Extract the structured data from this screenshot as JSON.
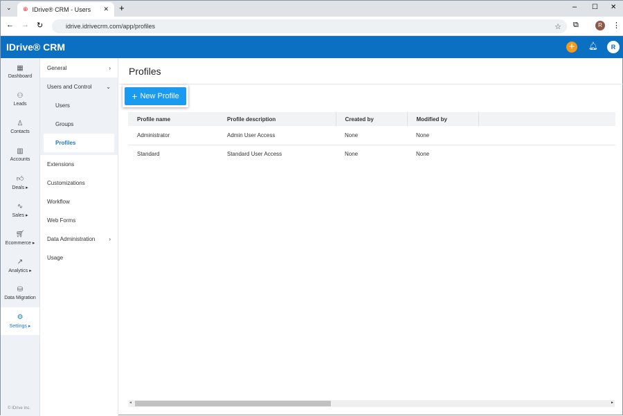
{
  "browser": {
    "tab_title": "IDrive® CRM - Users",
    "url": "idrive.idrivecrm.com/app/profiles",
    "profile_initial": "R"
  },
  "app": {
    "logo": "IDrive® CRM",
    "user_initial": "R"
  },
  "rail": [
    {
      "label": "Dashboard",
      "icon": "dashboard-icon"
    },
    {
      "label": "Leads",
      "icon": "leads-icon"
    },
    {
      "label": "Contacts",
      "icon": "contacts-icon"
    },
    {
      "label": "Accounts",
      "icon": "accounts-icon"
    },
    {
      "label": "Deals ▸",
      "icon": "deals-icon"
    },
    {
      "label": "Sales ▸",
      "icon": "sales-icon"
    },
    {
      "label": "Ecommerce ▸",
      "icon": "ecommerce-icon"
    },
    {
      "label": "Analytics ▸",
      "icon": "analytics-icon"
    },
    {
      "label": "Data Migration",
      "icon": "data-migration-icon"
    },
    {
      "label": "Settings ▸",
      "icon": "settings-icon"
    }
  ],
  "footer": "© IDrive Inc.",
  "settings_nav": {
    "general": "General",
    "users_control": "Users and Control",
    "users": "Users",
    "groups": "Groups",
    "profiles": "Profiles",
    "extensions": "Extensions",
    "customizations": "Customizations",
    "workflow": "Workflow",
    "web_forms": "Web Forms",
    "data_admin": "Data Administration",
    "usage": "Usage"
  },
  "page": {
    "title": "Profiles",
    "new_button": "New Profile"
  },
  "table": {
    "headers": [
      "Profile name",
      "Profile description",
      "Created by",
      "Modified by"
    ],
    "rows": [
      [
        "Administrator",
        "Admin User Access",
        "None",
        "None"
      ],
      [
        "Standard",
        "Standard User Access",
        "None",
        "None"
      ]
    ]
  },
  "colors": {
    "brand": "#0b6fc2",
    "button": "#1a9bf0",
    "accent_plus": "#f39a1e"
  }
}
